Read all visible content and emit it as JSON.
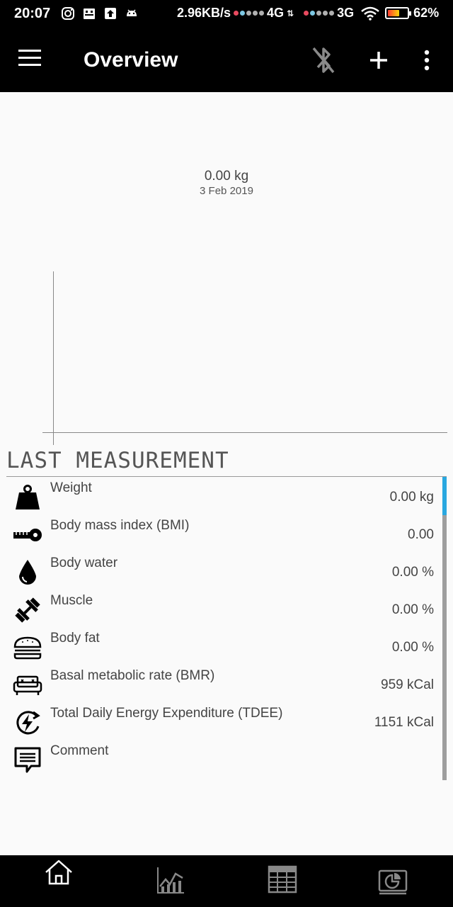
{
  "status_bar": {
    "time": "20:07",
    "speed": "2.96KB/s",
    "net1": "4G",
    "net2": "3G",
    "battery": "62%",
    "battery_level": 0.62,
    "left_icons": [
      "instagram-icon",
      "android-icon",
      "upload-icon",
      "android-small-icon"
    ]
  },
  "app_bar": {
    "title": "Overview",
    "icons": [
      "menu-icon",
      "bluetooth-disabled-icon",
      "add-icon",
      "more-vert-icon"
    ]
  },
  "chart": {
    "point_value": "0.00 kg",
    "point_date": "3 Feb 2019"
  },
  "last_measurement": {
    "title": "LAST MEASUREMENT",
    "rows": [
      {
        "label": "Weight",
        "value": "0.00 kg",
        "icon": "weight-icon"
      },
      {
        "label": "Body mass index (BMI)",
        "value": "0.00",
        "icon": "tape-measure-icon"
      },
      {
        "label": "Body water",
        "value": "0.00 %",
        "icon": "water-drop-icon"
      },
      {
        "label": "Muscle",
        "value": "0.00 %",
        "icon": "dumbbell-icon"
      },
      {
        "label": "Body fat",
        "value": "0.00 %",
        "icon": "burger-icon"
      },
      {
        "label": "Basal metabolic rate (BMR)",
        "value": "959 kCal",
        "icon": "sofa-icon"
      },
      {
        "label": "Total Daily Energy Expenditure (TDEE)",
        "value": "1151 kCal",
        "icon": "energy-cycle-icon"
      },
      {
        "label": "Comment",
        "value": "",
        "icon": "comment-icon"
      }
    ]
  },
  "bottom_nav": [
    "home-icon",
    "graph-icon",
    "table-icon",
    "statistics-icon"
  ],
  "colors": {
    "bar_bg": "#000000",
    "page_bg": "#fafafa",
    "accent": "#29a8e0"
  }
}
